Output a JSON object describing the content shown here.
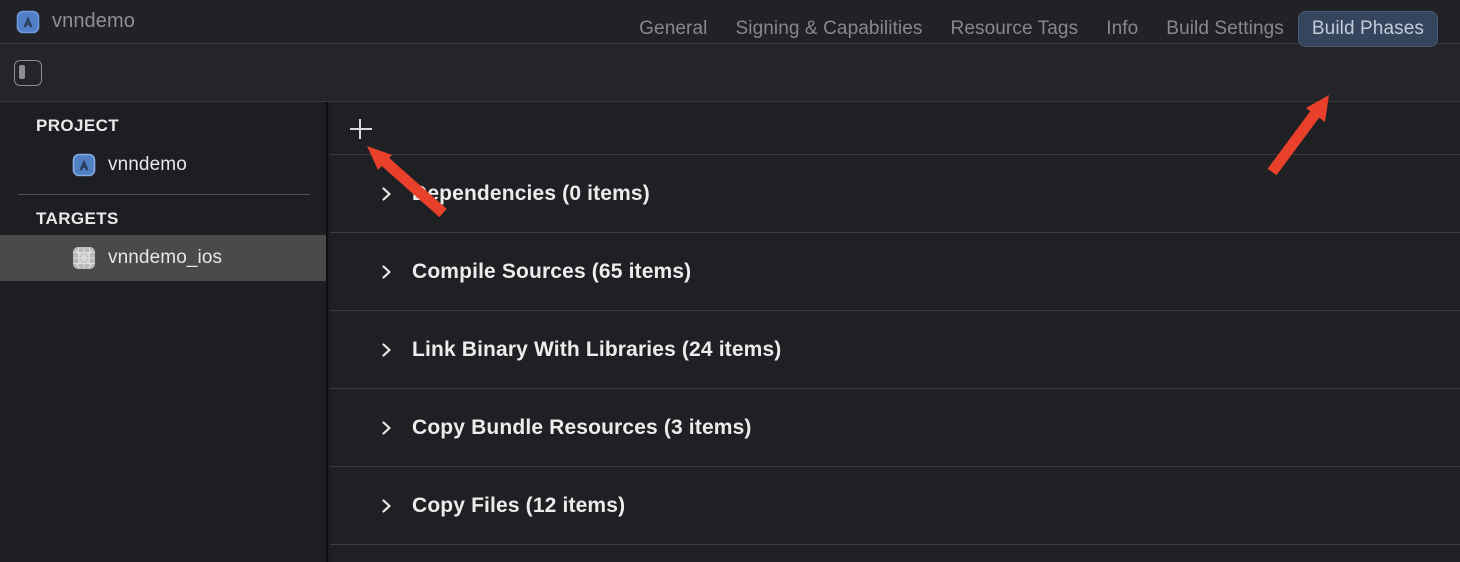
{
  "window": {
    "title": "vnndemo",
    "app_icon": "appstore-icon"
  },
  "toolbar": {
    "sidebar_toggle_icon": "sidebar-toggle-icon"
  },
  "tabs": [
    {
      "label": "General",
      "selected": false
    },
    {
      "label": "Signing & Capabilities",
      "selected": false
    },
    {
      "label": "Resource Tags",
      "selected": false
    },
    {
      "label": "Info",
      "selected": false
    },
    {
      "label": "Build Settings",
      "selected": false
    },
    {
      "label": "Build Phases",
      "selected": true
    }
  ],
  "sidebar": {
    "project_header": "PROJECT",
    "targets_header": "TARGETS",
    "project_items": [
      {
        "label": "vnndemo",
        "icon": "appstore-icon",
        "selected": false
      }
    ],
    "target_items": [
      {
        "label": "vnndemo_ios",
        "icon": "target-grid-icon",
        "selected": true
      }
    ]
  },
  "content": {
    "add_button_label": "+",
    "add_button_icon": "plus-icon",
    "phases": [
      {
        "label": "Dependencies (0 items)",
        "expanded": false
      },
      {
        "label": "Compile Sources (65 items)",
        "expanded": false
      },
      {
        "label": "Link Binary With Libraries (24 items)",
        "expanded": false
      },
      {
        "label": "Copy Bundle Resources (3 items)",
        "expanded": false
      },
      {
        "label": "Copy Files (12 items)",
        "expanded": false
      }
    ]
  },
  "annotations": {
    "color": "#e8402a",
    "arrows": [
      {
        "name": "arrow-to-add-button",
        "points_to": "add-button"
      },
      {
        "name": "arrow-to-build-phases-tab",
        "points_to": "tab-build-phases"
      }
    ]
  },
  "colors": {
    "titlebar_bg": "#212226",
    "tabbar_bg": "#242528",
    "sidebar_bg": "#1d1e21",
    "content_bg": "#1f2023",
    "selected_tab_bg": "#36455e",
    "selected_row_bg": "#4a4a4a",
    "accent_red": "#e8402a"
  }
}
